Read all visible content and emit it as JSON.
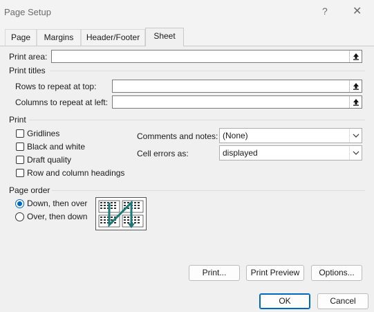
{
  "window": {
    "title": "Page Setup",
    "help_glyph": "?",
    "close_glyph": "✕"
  },
  "tabs": [
    {
      "label": "Page"
    },
    {
      "label": "Margins"
    },
    {
      "label": "Header/Footer"
    },
    {
      "label": "Sheet"
    }
  ],
  "print_area": {
    "label": "Print area:",
    "value": ""
  },
  "print_titles": {
    "heading": "Print titles",
    "rows_label": "Rows to repeat at top:",
    "rows_value": "",
    "cols_label": "Columns to repeat at left:",
    "cols_value": ""
  },
  "print": {
    "heading": "Print",
    "gridlines": {
      "label": "Gridlines",
      "checked": false
    },
    "black_white": {
      "label": "Black and white",
      "checked": false
    },
    "draft_quality": {
      "label": "Draft quality",
      "checked": false
    },
    "row_col_headings": {
      "label": "Row and column headings",
      "checked": false
    },
    "comments_label": "Comments and notes:",
    "comments_value": "(None)",
    "errors_label": "Cell errors as:",
    "errors_value": "displayed"
  },
  "page_order": {
    "heading": "Page order",
    "down_then_over": {
      "label": "Down, then over",
      "selected": true
    },
    "over_then_down": {
      "label": "Over, then down",
      "selected": false
    }
  },
  "buttons": {
    "print": "Print...",
    "print_preview": "Print Preview",
    "options": "Options...",
    "ok": "OK",
    "cancel": "Cancel"
  },
  "colors": {
    "accent": "#0067c0",
    "dialog_bg": "#f0f0f0",
    "preview_arrow": "#1a7a7a"
  }
}
